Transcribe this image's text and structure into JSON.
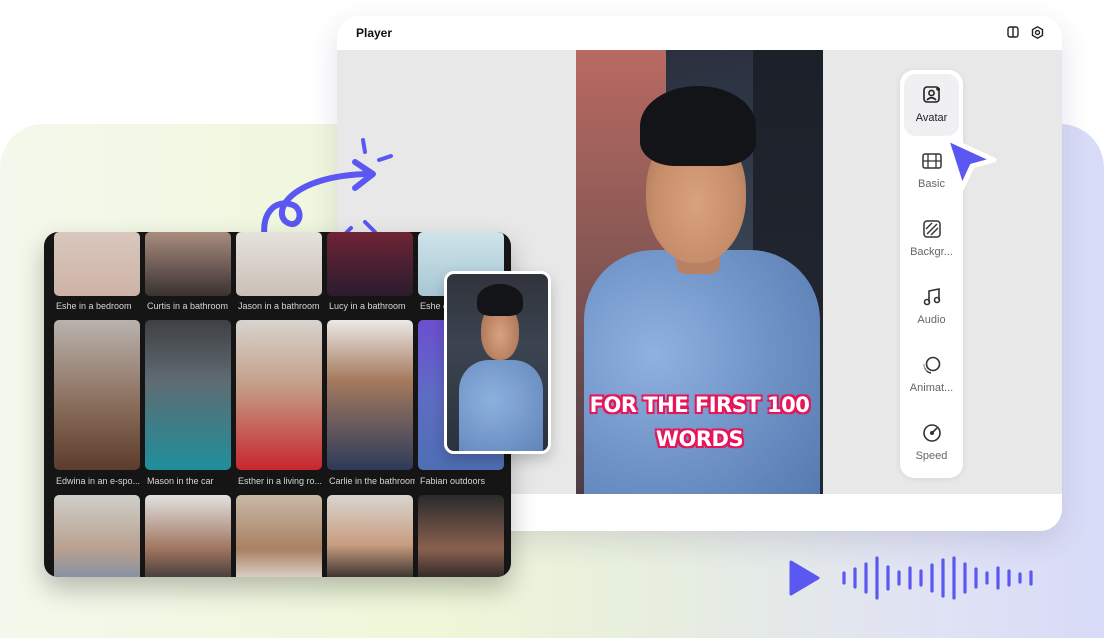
{
  "player": {
    "title": "Player",
    "caption_line1": "FOR THE FIRST 100",
    "caption_line2": "WORDS"
  },
  "toolbar": {
    "items": [
      {
        "label": "Avatar",
        "icon": "avatar-icon",
        "active": true
      },
      {
        "label": "Basic",
        "icon": "film-icon"
      },
      {
        "label": "Backgr...",
        "icon": "background-icon"
      },
      {
        "label": "Audio",
        "icon": "music-icon"
      },
      {
        "label": "Animat...",
        "icon": "animation-icon"
      },
      {
        "label": "Speed",
        "icon": "speed-icon"
      }
    ]
  },
  "gallery": {
    "row1": [
      "Eshe in a bedroom",
      "Curtis in a bathroom",
      "Jason in a bathroom",
      "Lucy in a bathroom",
      "Eshe c"
    ],
    "row2": [
      "Edwina in an e-spo...",
      "Mason in the car",
      "Esther in a living ro...",
      "Carlie in the bathroom",
      "Fabian outdoors"
    ]
  },
  "colors": {
    "accent": "#5b57f2",
    "caption_outline": "#e7155a"
  }
}
